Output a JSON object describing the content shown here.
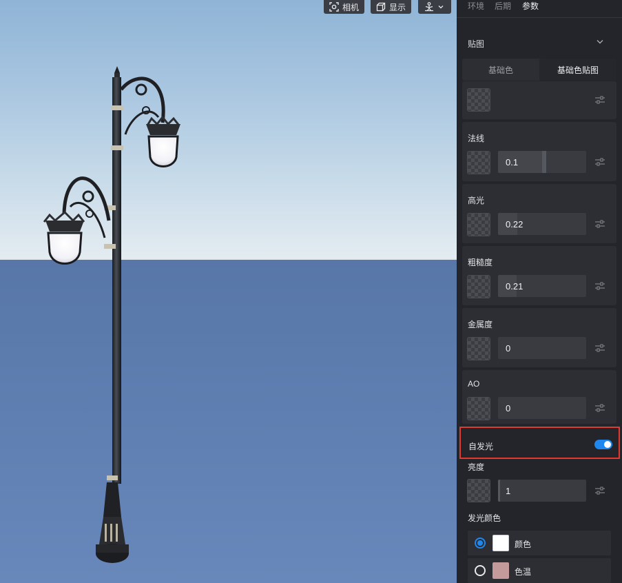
{
  "toolbar": {
    "camera_label": "相机",
    "display_label": "显示"
  },
  "tabs": [
    {
      "label": "环境",
      "active": false
    },
    {
      "label": "后期",
      "active": false
    },
    {
      "label": "参数",
      "active": true
    }
  ],
  "texture_section": {
    "title": "贴图",
    "segments": [
      "基础色",
      "基础色贴图"
    ],
    "active_segment": 1
  },
  "params": [
    {
      "label": "法线",
      "value": "0.1"
    },
    {
      "label": "高光",
      "value": "0.22"
    },
    {
      "label": "粗糙度",
      "value": "0.21"
    },
    {
      "label": "金属度",
      "value": "0"
    },
    {
      "label": "AO",
      "value": "0"
    }
  ],
  "emissive": {
    "label": "自发光",
    "enabled": true,
    "brightness_label": "亮度",
    "brightness_value": "1",
    "color_label": "发光颜色",
    "options": [
      {
        "label": "颜色",
        "selected": true,
        "swatch": "#ffffff"
      },
      {
        "label": "色温",
        "selected": false,
        "swatch": "#c59a9a"
      }
    ]
  },
  "colors": {
    "accent": "#1e88ee",
    "highlight_border": "#e23a2e",
    "panel_bg": "#23252a"
  }
}
